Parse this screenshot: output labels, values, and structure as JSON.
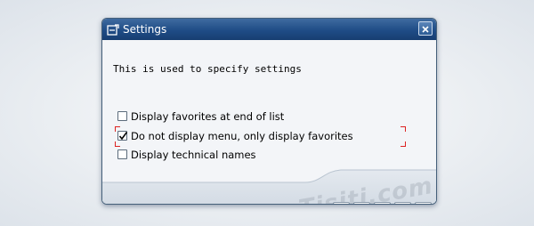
{
  "dialog": {
    "title": "Settings",
    "title_icon": "settings-window-icon",
    "close_icon": "close-icon"
  },
  "description": "This is used to specify settings",
  "options": [
    {
      "label": "Display favorites at end of list",
      "checked": false
    },
    {
      "label": "Do not display menu, only display favorites",
      "checked": true
    },
    {
      "label": "Display technical names",
      "checked": false
    }
  ],
  "toolbar": {
    "buttons": [
      {
        "icon": "checkmark-icon"
      },
      {
        "icon": "select-pointer-icon"
      },
      {
        "icon": "list-details-icon"
      },
      {
        "icon": "document-icon"
      },
      {
        "icon": "cancel-x-icon"
      }
    ]
  },
  "watermark": "Tisiti.com",
  "colors": {
    "titlebar": "#1f4c86",
    "focus_bracket": "#dd2222",
    "check_green": "#2e8b1f",
    "cancel_red": "#c8141e"
  }
}
